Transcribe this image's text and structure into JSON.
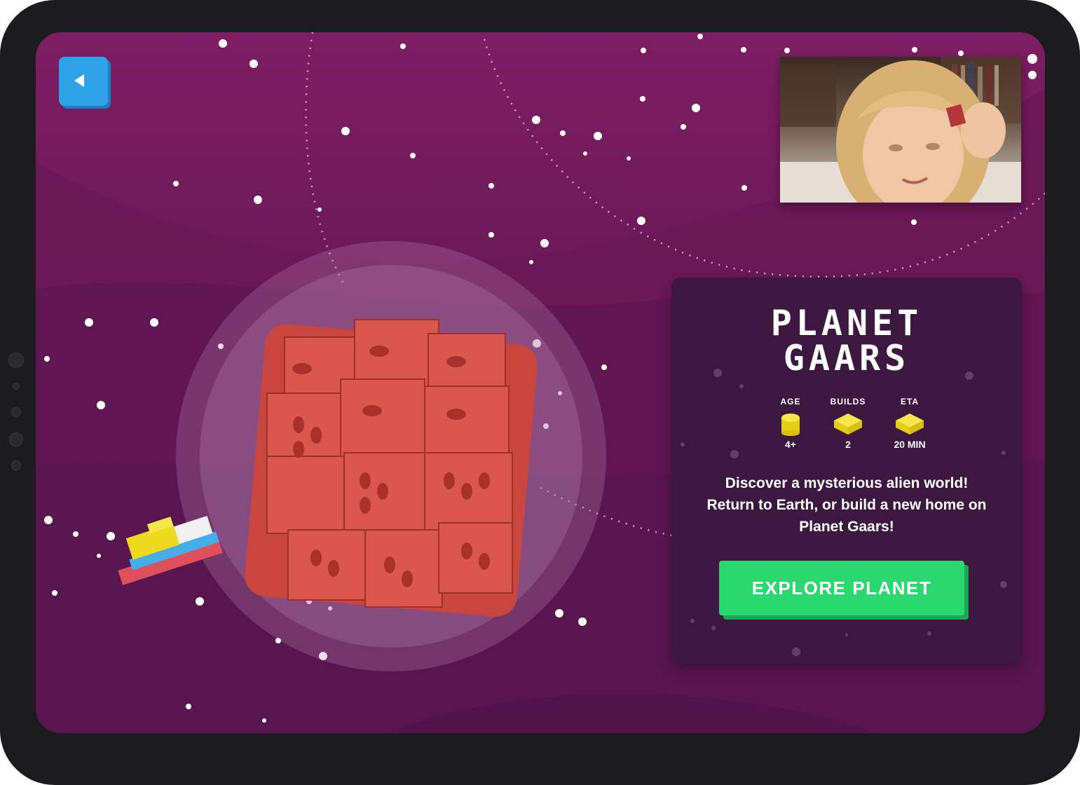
{
  "app": {
    "back_button_icon": "back-arrow-icon",
    "video_feed_icon": "webcam-video-feed"
  },
  "planet": {
    "title_line1": "PLANET",
    "title_line2": "GAARS",
    "stats": [
      {
        "label": "AGE",
        "value": "4+",
        "icon": "brick-1x1-icon"
      },
      {
        "label": "BUILDS",
        "value": "2",
        "icon": "brick-2x2-icon"
      },
      {
        "label": "ETA",
        "value": "20 MIN",
        "icon": "brick-2x2-icon"
      }
    ],
    "description": "Discover a mysterious alien world! Return to Earth, or build a new home on Planet Gaars!",
    "cta_label": "EXPLORE PLANET"
  },
  "colors": {
    "background": "#6e1a5a",
    "card": "#3c1740",
    "cta": "#2bd86f",
    "back_button": "#2ea3e8",
    "brick_yellow": "#f4e11a",
    "planet_red": "#d0524a"
  }
}
